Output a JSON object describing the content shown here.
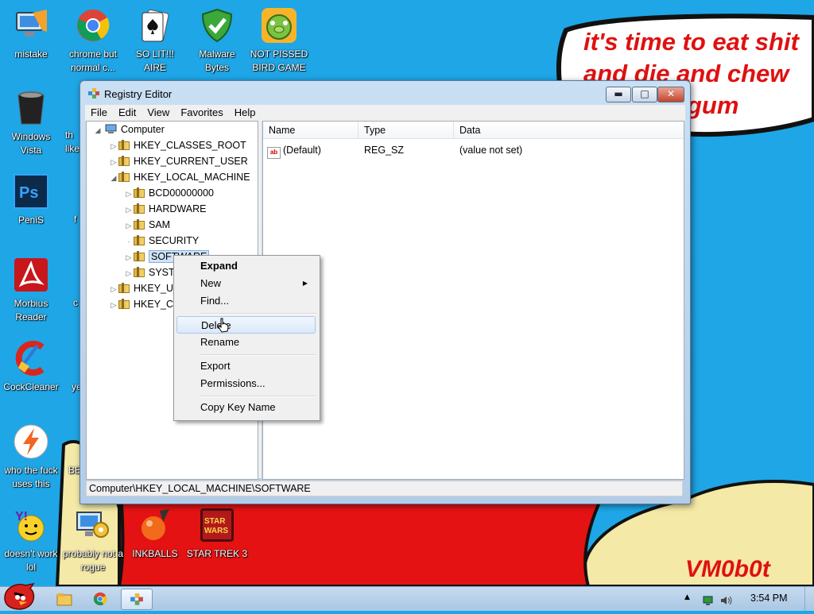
{
  "desktop": {
    "icons": [
      {
        "label": "mistake",
        "icon": "computer-icon"
      },
      {
        "label": "chrome but normal c...",
        "icon": "chrome-icon"
      },
      {
        "label": "SO LIT!!! AIRE",
        "icon": "solitaire-icon"
      },
      {
        "label": "Malware Bytes",
        "icon": "shield-check-icon"
      },
      {
        "label": "NOT PISSED BIRD GAME",
        "icon": "green-pig-icon"
      },
      {
        "label": "Windows Vista",
        "icon": "trash-bin-icon"
      },
      {
        "label": "PeniS",
        "icon": "photoshop-icon"
      },
      {
        "label": "Morbius Reader",
        "icon": "pdf-reader-icon"
      },
      {
        "label": "CockCleaner",
        "icon": "broom-icon"
      },
      {
        "label": "who the fuck uses this",
        "icon": "lightning-icon"
      },
      {
        "label": "doesn't work lol",
        "icon": "yahoo-icon"
      },
      {
        "label": "probably not a rogue",
        "icon": "gears-computer-icon"
      },
      {
        "label": "INKBALLS",
        "icon": "inkball-icon"
      },
      {
        "label": "STAR TREK 3",
        "icon": "star-wars-icon"
      }
    ],
    "partial_labels": [
      "th",
      "like",
      "f",
      "c",
      "ye",
      "BE"
    ],
    "caption_lines": [
      "it's time to eat shit",
      "and die and chew",
      "gum"
    ],
    "signature": "VM0b0t",
    "colors": {
      "sky": "#1ea6e6",
      "red": "#e01010",
      "yellow": "#f4e9a6",
      "black": "#111111"
    }
  },
  "window": {
    "title": "Registry Editor",
    "controls": [
      "minimize",
      "maximize",
      "close"
    ],
    "menu": [
      "File",
      "Edit",
      "View",
      "Favorites",
      "Help"
    ],
    "tree": [
      {
        "label": "Computer",
        "expander": "expanded"
      },
      {
        "label": "HKEY_CLASSES_ROOT",
        "expander": "collapsed"
      },
      {
        "label": "HKEY_CURRENT_USER",
        "expander": "collapsed"
      },
      {
        "label": "HKEY_LOCAL_MACHINE",
        "expander": "expanded"
      },
      {
        "label": "BCD00000000",
        "expander": "collapsed"
      },
      {
        "label": "HARDWARE",
        "expander": "collapsed"
      },
      {
        "label": "SAM",
        "expander": "collapsed"
      },
      {
        "label": "SECURITY",
        "expander": "none"
      },
      {
        "label": "SOFTWARE",
        "expander": "collapsed",
        "selected": true
      },
      {
        "label": "SYSTEM",
        "expander": "collapsed"
      },
      {
        "label": "HKEY_USERS",
        "expander": "collapsed"
      },
      {
        "label": "HKEY_CURRENT_CONFIG",
        "expander": "collapsed"
      }
    ],
    "columns": [
      "Name",
      "Type",
      "Data"
    ],
    "values": [
      {
        "name": "(Default)",
        "type": "REG_SZ",
        "data": "(value not set)",
        "icon": "string-value-icon"
      }
    ],
    "status": "Computer\\HKEY_LOCAL_MACHINE\\SOFTWARE"
  },
  "context_menu": {
    "items": [
      "Expand",
      "New",
      "Find...",
      "Delete",
      "Rename",
      "Export",
      "Permissions...",
      "Copy Key Name"
    ],
    "bold_item": "Expand",
    "submenu_item": "New",
    "hovered_item": "Delete"
  },
  "taskbar": {
    "start": "angry-bird-start-icon",
    "pinned": [
      "explorer-icon",
      "chrome-icon",
      "regedit-icon"
    ],
    "tray_icons": [
      "show-hidden-icons-arrow",
      "network-icon",
      "volume-icon"
    ],
    "clock": "3:54 PM"
  }
}
